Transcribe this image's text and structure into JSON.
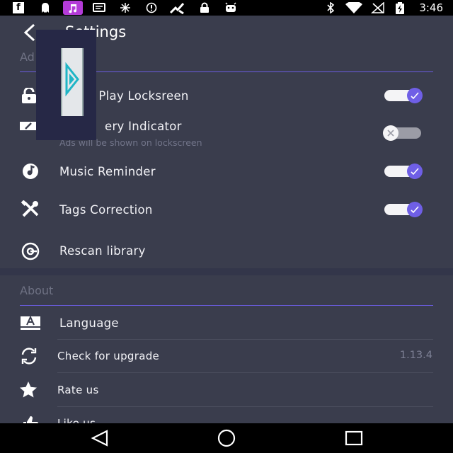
{
  "status_bar": {
    "time": "3:46",
    "icons": [
      "facebook-icon",
      "ghost-icon",
      "music-app-icon",
      "message-icon",
      "weather-icon",
      "blocked-icon",
      "app-icon",
      "lock-icon",
      "android-icon",
      "bluetooth-icon",
      "wifi-icon",
      "no-signal-icon",
      "battery-charging-icon"
    ]
  },
  "app_bar": {
    "title": "Settings"
  },
  "sections": {
    "general": {
      "header": "Ad"
    },
    "about": {
      "header": "About"
    }
  },
  "settings": {
    "lockscreen": {
      "label": "k Play Locksreen",
      "icon": "lock-icon",
      "toggle": true
    },
    "battery": {
      "label": "ery Indicator",
      "sublabel": "Ads will be shown on lockscreen",
      "icon": "battery-icon",
      "toggle": false
    },
    "music_reminder": {
      "label": "Music Reminder",
      "icon": "music-note-icon",
      "toggle": true
    },
    "tags_correction": {
      "label": "Tags Correction",
      "icon": "tools-icon",
      "toggle": true
    },
    "rescan": {
      "label": "Rescan library",
      "icon": "rescan-icon"
    }
  },
  "about": {
    "language": {
      "label": "Language",
      "icon": "language-icon"
    },
    "upgrade": {
      "label": "Check for upgrade",
      "value": "1.13.4",
      "icon": "refresh-icon"
    },
    "rate": {
      "label": "Rate us",
      "icon": "star-icon"
    },
    "like": {
      "label": "Like us",
      "icon": "thumbs-up-icon"
    }
  },
  "colors": {
    "background": "#3a3d4d",
    "accent": "#6f5fe6",
    "status_bar": "#000000",
    "section_header": "#6e7183"
  }
}
